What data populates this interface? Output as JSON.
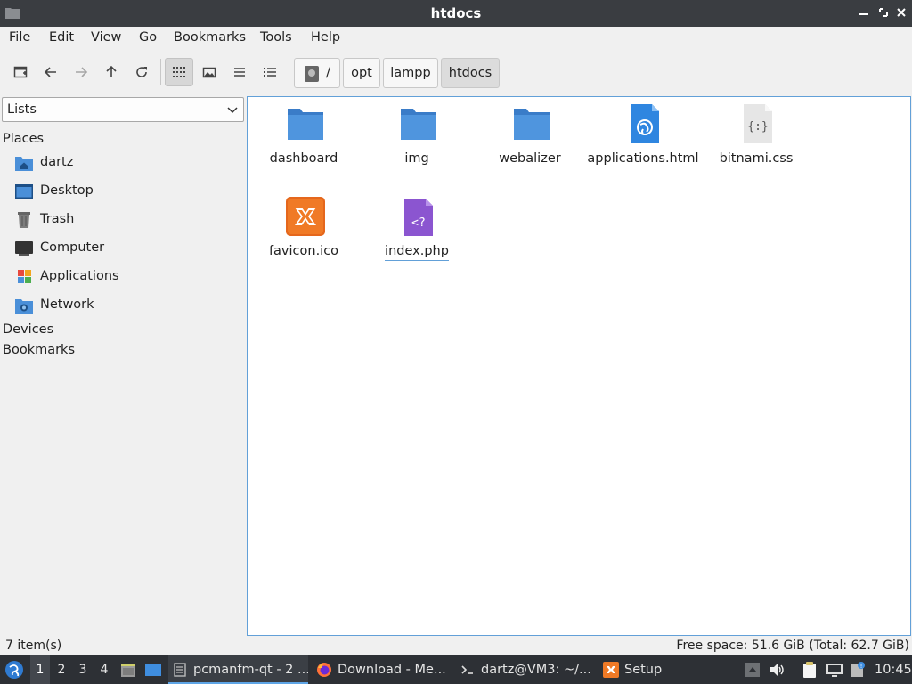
{
  "window": {
    "title": "htdocs"
  },
  "menu": {
    "items": [
      "File",
      "Edit",
      "View",
      "Go",
      "Bookmarks",
      "Tools",
      "Help"
    ]
  },
  "toolbar": {
    "buttons": [
      "new-tab-icon",
      "back-icon",
      "forward-icon",
      "up-icon",
      "reload-icon",
      "icon-view-icon",
      "thumbnail-view-icon",
      "compact-view-icon",
      "detailed-list-view-icon"
    ],
    "active_view": "icon-view-icon",
    "breadcrumb": [
      "/",
      "opt",
      "lampp",
      "htdocs"
    ]
  },
  "sidepanel": {
    "mode": "Lists",
    "places_label": "Places",
    "places": [
      {
        "label": "dartz",
        "icon": "home-folder-icon"
      },
      {
        "label": "Desktop",
        "icon": "desktop-icon"
      },
      {
        "label": "Trash",
        "icon": "trash-icon"
      },
      {
        "label": "Computer",
        "icon": "computer-icon"
      },
      {
        "label": "Applications",
        "icon": "applications-icon"
      },
      {
        "label": "Network",
        "icon": "network-icon"
      }
    ],
    "devices_label": "Devices",
    "bookmarks_label": "Bookmarks"
  },
  "files": [
    {
      "name": "dashboard",
      "icon": "folder-icon"
    },
    {
      "name": "img",
      "icon": "folder-icon"
    },
    {
      "name": "webalizer",
      "icon": "folder-icon"
    },
    {
      "name": "applications.html",
      "icon": "html-file-icon"
    },
    {
      "name": "bitnami.css",
      "icon": "css-file-icon"
    },
    {
      "name": "favicon.ico",
      "icon": "xampp-icon"
    },
    {
      "name": "index.php",
      "icon": "php-file-icon"
    }
  ],
  "status": {
    "items": "7 item(s)",
    "free_space": "Free space: 51.6 GiB (Total: 62.7 GiB)"
  },
  "taskbar": {
    "workspaces": [
      "1",
      "2",
      "3",
      "4"
    ],
    "active_workspace": "1",
    "tasks": [
      {
        "label": "pcmanfm-qt - 2 ...",
        "icon": "file-manager-icon"
      },
      {
        "label": "Download - Me...",
        "icon": "firefox-icon"
      },
      {
        "label": "dartz@VM3: ~/...",
        "icon": "terminal-icon"
      },
      {
        "label": "Setup",
        "icon": "xampp-icon"
      }
    ],
    "clock": "10:45"
  },
  "colors": {
    "accent": "#62a0d8",
    "folder": "#4a8fd8",
    "titlebar": "#3a3d41",
    "taskbar": "#2d3035"
  }
}
